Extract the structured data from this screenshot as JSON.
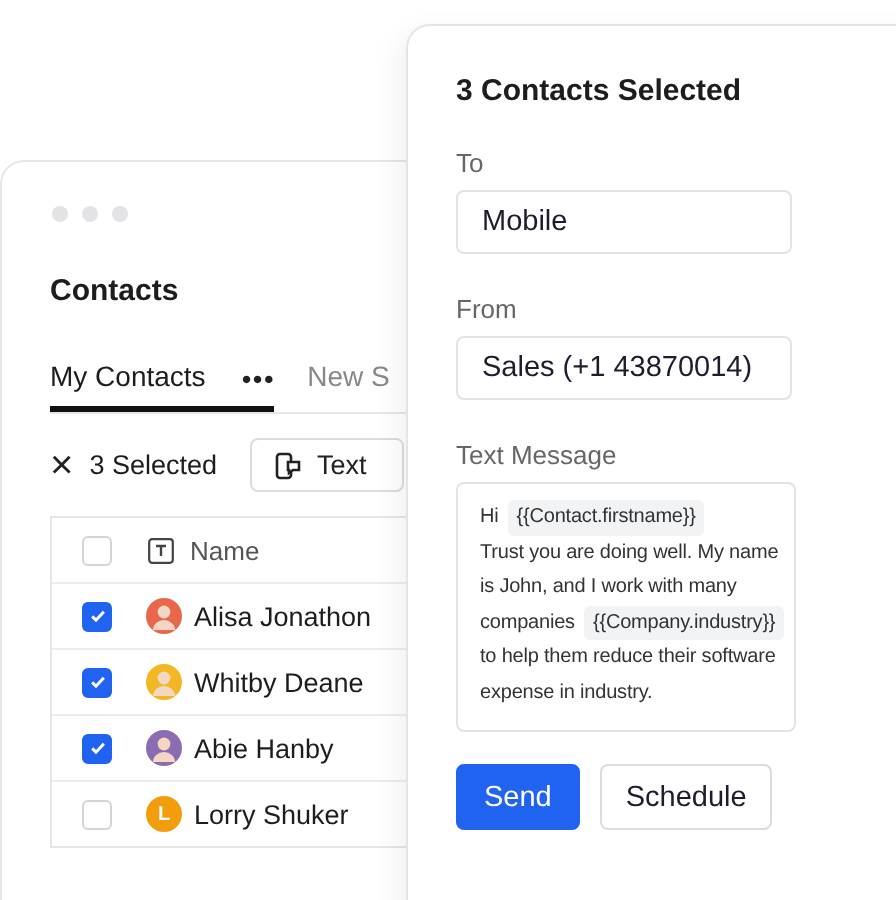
{
  "contacts_card": {
    "title": "Contacts",
    "tabs": [
      {
        "label": "My Contacts",
        "selected": true
      },
      {
        "label": "New S",
        "selected": false
      }
    ],
    "more_menu": "•••",
    "selection": {
      "close": "×",
      "count": "3 Selected",
      "action": "Text"
    },
    "table": {
      "columns": [
        "Name"
      ],
      "select_all": false,
      "rows": [
        {
          "name": "Alisa Jonathon",
          "checked": true,
          "avatar": {
            "kind": "photo",
            "color": "#e8664a"
          }
        },
        {
          "name": "Whitby Deane",
          "checked": true,
          "avatar": {
            "kind": "photo",
            "color": "#f2b824"
          }
        },
        {
          "name": "Abie Hanby",
          "checked": true,
          "avatar": {
            "kind": "photo",
            "color": "#8a6db0"
          }
        },
        {
          "name": "Lorry Shuker",
          "checked": false,
          "avatar": {
            "kind": "initial",
            "initial": "L",
            "color": "#f29e0c"
          }
        }
      ]
    }
  },
  "sms_panel": {
    "title": "3 Contacts Selected",
    "fields": [
      {
        "label": "To",
        "value": "Mobile"
      },
      {
        "label": "From",
        "value": "Sales (+1 43870014)"
      }
    ],
    "message": {
      "label": "Text Message",
      "lines": [
        [
          {
            "kind": "text",
            "text": "Hi"
          },
          {
            "kind": "token",
            "text": "{{Contact.firstname}}"
          }
        ],
        [
          {
            "kind": "text",
            "text": "Trust you are doing well. My name"
          }
        ],
        [
          {
            "kind": "text",
            "text": "is John, and I work with many"
          }
        ],
        [
          {
            "kind": "text",
            "text": "companies"
          },
          {
            "kind": "token",
            "text": "{{Company.industry}}"
          }
        ],
        [
          {
            "kind": "text",
            "text": "to help them reduce their software"
          }
        ],
        [
          {
            "kind": "text",
            "text": "expense in industry."
          }
        ]
      ]
    },
    "buttons": [
      {
        "label": "Send",
        "kind": "primary"
      },
      {
        "label": "Schedule",
        "kind": "secondary"
      }
    ]
  }
}
